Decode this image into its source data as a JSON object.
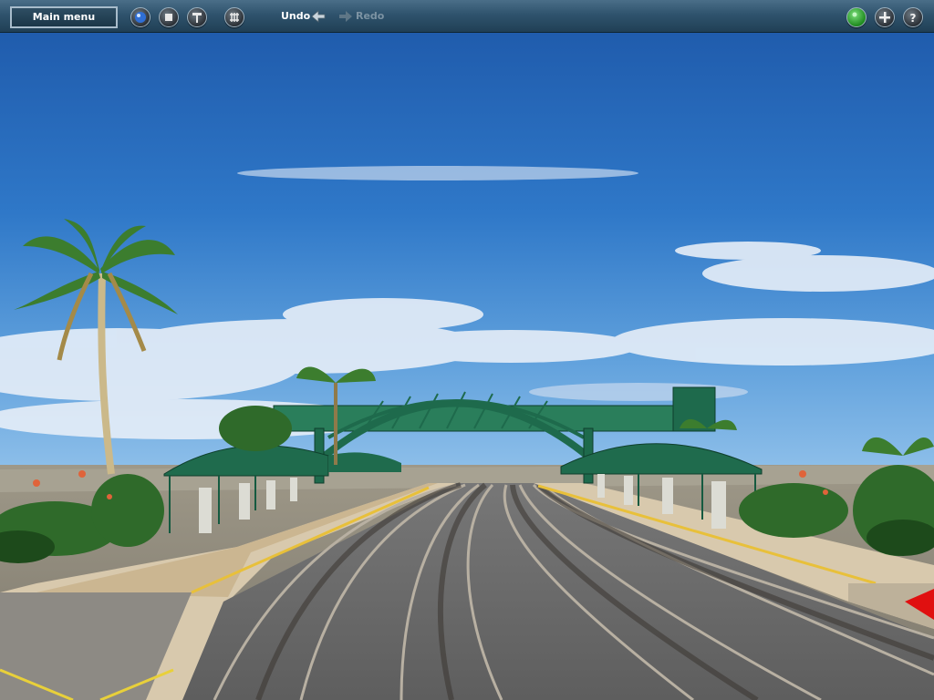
{
  "toolbar": {
    "main_menu_label": "Main menu",
    "undo_label": "Undo",
    "redo_label": "Redo",
    "left_icons": [
      "camera-view-icon",
      "stop-icon",
      "track-tool-icon",
      "grid-icon"
    ],
    "right_icons": [
      "status-light-icon",
      "add-icon",
      "help-icon"
    ]
  },
  "colors": {
    "toolbar": "#2f536d",
    "sky": "#2a6fc0",
    "canopy": "#1f6b4d",
    "status_light": "#3cc23c"
  }
}
